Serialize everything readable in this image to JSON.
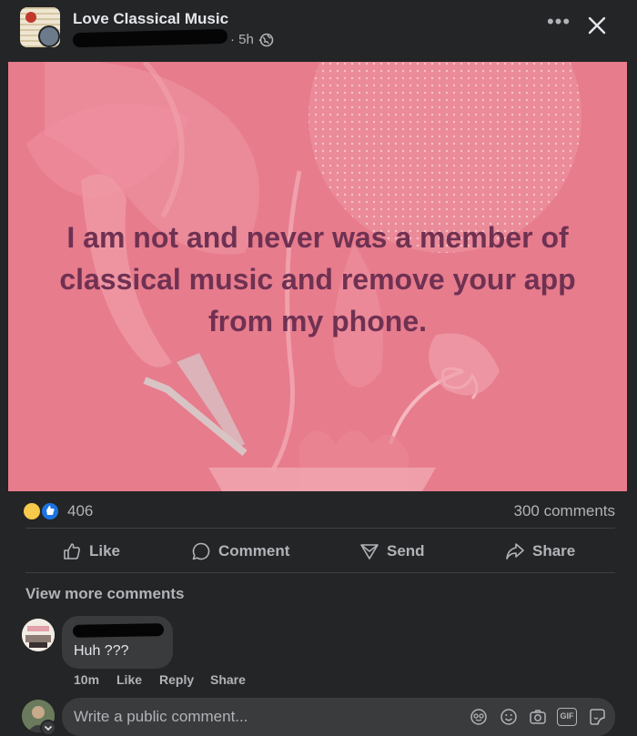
{
  "header": {
    "page_title": "Love Classical Music",
    "time": "· 5h ·",
    "more_label": "•••"
  },
  "post": {
    "text": "I am not and never was a member of classical music and remove your app from my phone."
  },
  "reactions": {
    "count": "406",
    "comments": "300 comments"
  },
  "actions": {
    "like": "Like",
    "comment": "Comment",
    "send": "Send",
    "share": "Share"
  },
  "comments_section": {
    "view_more": "View more comments",
    "items": [
      {
        "text": "Huh ???",
        "time": "10m",
        "like": "Like",
        "reply": "Reply",
        "share": "Share"
      }
    ]
  },
  "composer": {
    "placeholder": "Write a public comment...",
    "gif_label": "GIF"
  },
  "colors": {
    "background": "#242526",
    "post_background": "#e77c8d",
    "post_text": "#6f3152",
    "like_blue": "#1b74e4"
  },
  "icons": [
    "globe-icon",
    "more-icon",
    "close-icon",
    "like-icon",
    "comment-icon",
    "send-icon",
    "share-icon",
    "avatar-icon",
    "sticker-icon",
    "emoji-icon",
    "camera-icon",
    "gif-icon",
    "comment-sticker-icon"
  ]
}
